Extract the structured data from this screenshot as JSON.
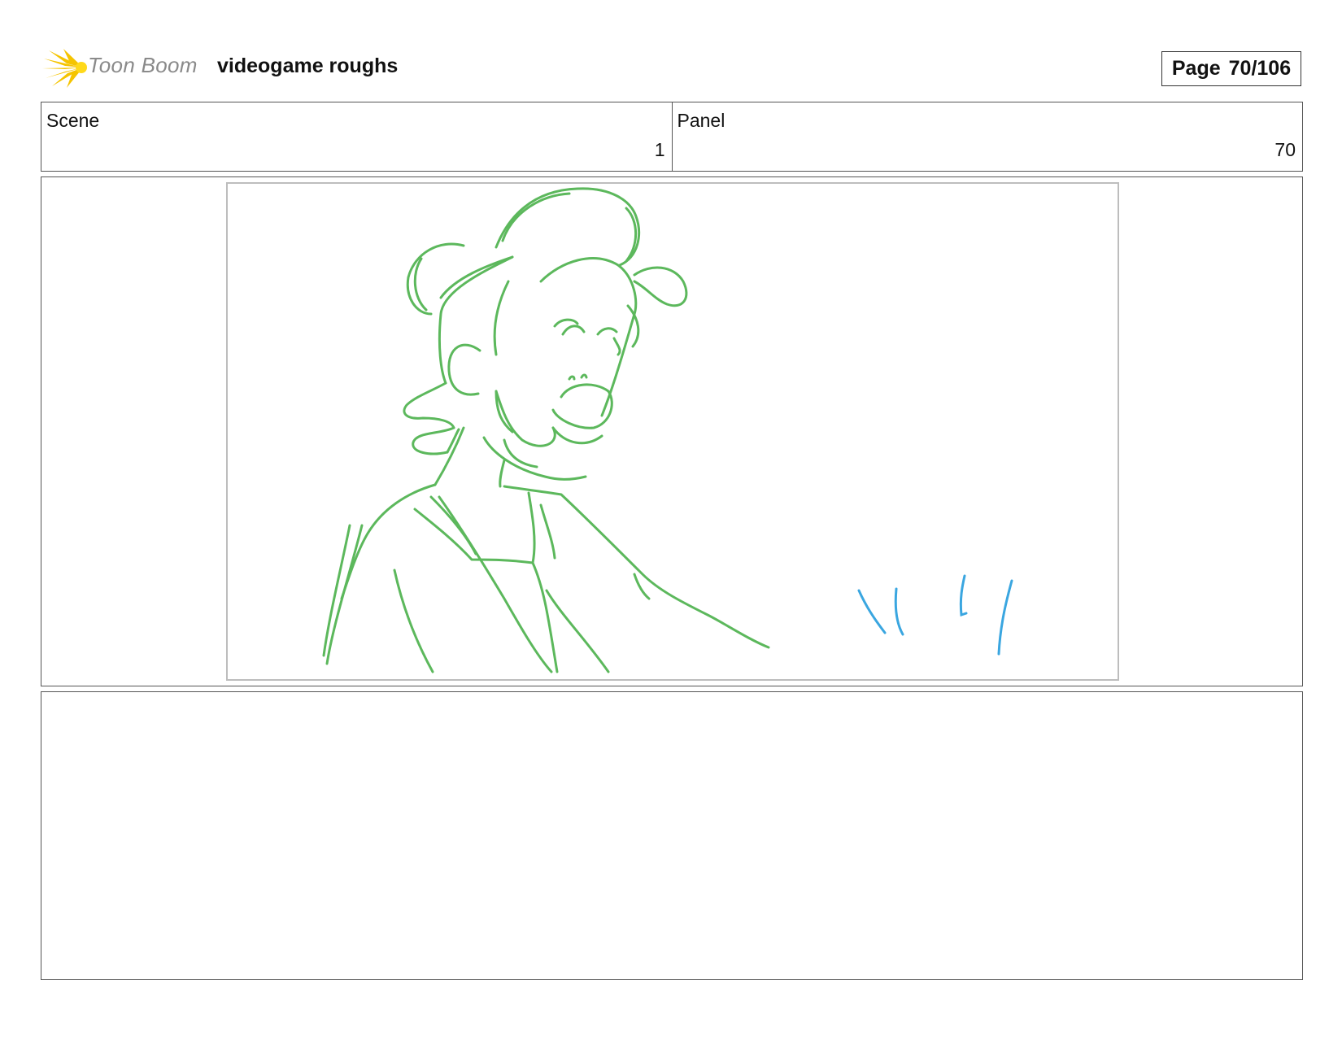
{
  "header": {
    "logo_text": "Toon Boom",
    "document_title": "videogame roughs",
    "page_label": "Page",
    "page_number": "70/106"
  },
  "info": {
    "scene_label": "Scene",
    "scene_value": "1",
    "panel_label": "Panel",
    "panel_value": "70"
  },
  "drawing": {
    "character_line_color": "#5cb85c",
    "effect_line_color": "#3aa6e0"
  },
  "notes": {
    "text": ""
  }
}
